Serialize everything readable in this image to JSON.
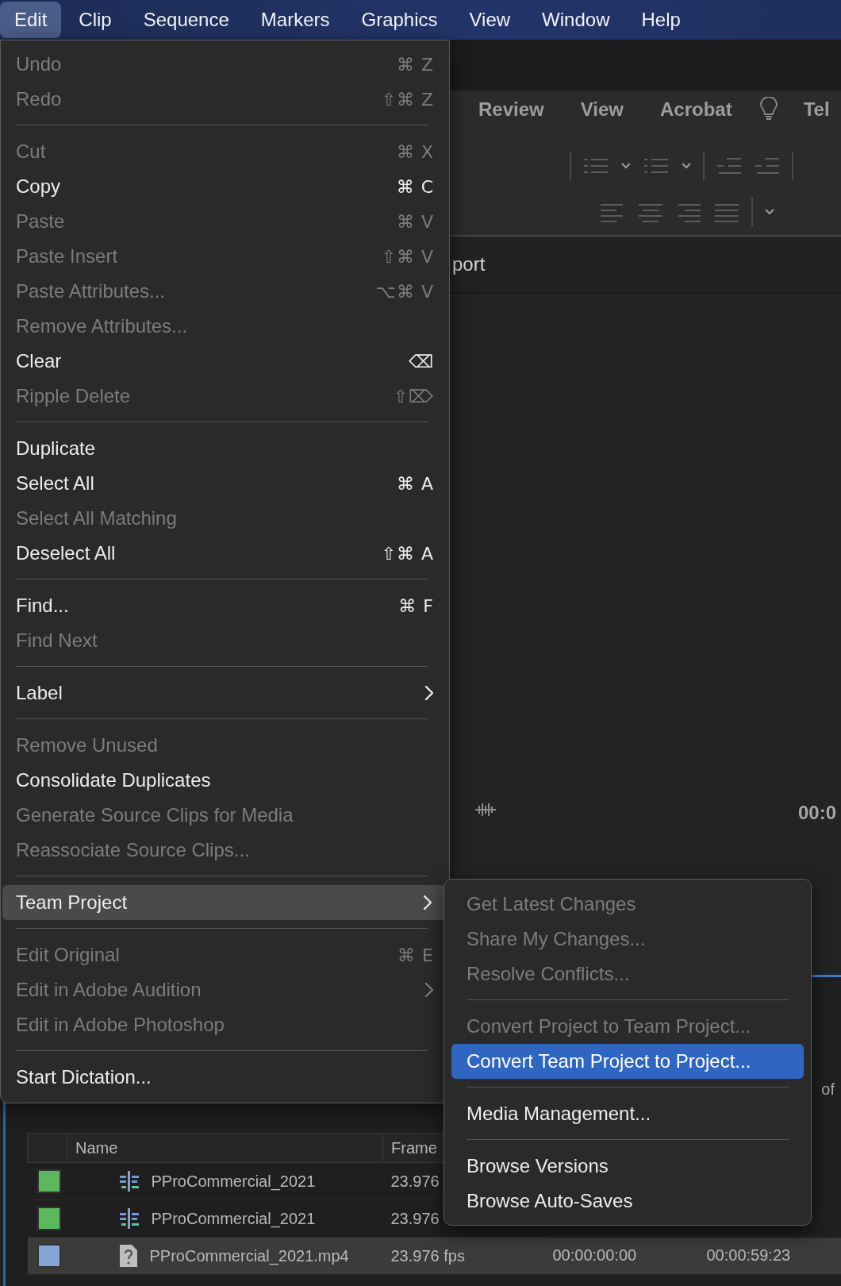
{
  "menu_bar": [
    {
      "label": "Edit",
      "selected": true
    },
    {
      "label": "Clip",
      "selected": false
    },
    {
      "label": "Sequence",
      "selected": false
    },
    {
      "label": "Markers",
      "selected": false
    },
    {
      "label": "Graphics",
      "selected": false
    },
    {
      "label": "View",
      "selected": false
    },
    {
      "label": "Window",
      "selected": false
    },
    {
      "label": "Help",
      "selected": false
    }
  ],
  "ribbon": {
    "tabs": [
      "Review",
      "View",
      "Acrobat",
      "Tel"
    ]
  },
  "export_bar": {
    "label": "port"
  },
  "monitor": {
    "timecode": "00:0"
  },
  "project_panel": {
    "page_label": "of"
  },
  "table": {
    "columns": [
      "Name",
      "Frame"
    ],
    "rows": [
      {
        "color": "#5cb85c",
        "kind": "sequence",
        "selected": false,
        "cells": [
          "PProCommercial_2021",
          "23.976"
        ]
      },
      {
        "color": "#5cb85c",
        "kind": "sequence",
        "selected": false,
        "cells": [
          "PProCommercial_2021",
          "23.976"
        ]
      },
      {
        "color": "#86a6d8",
        "kind": "file",
        "selected": true,
        "cells": [
          "PProCommercial_2021.mp4",
          "23.976 fps",
          "00:00:00:00",
          "00:00:59:23"
        ]
      }
    ]
  },
  "edit_menu": {
    "items": [
      {
        "kind": "item",
        "label": "Undo",
        "shortcut": "⌘ Z",
        "disabled": true,
        "selected": false,
        "has_submenu": false
      },
      {
        "kind": "item",
        "label": "Redo",
        "shortcut": "⇧⌘ Z",
        "disabled": true,
        "selected": false,
        "has_submenu": false
      },
      {
        "kind": "separator"
      },
      {
        "kind": "item",
        "label": "Cut",
        "shortcut": "⌘ X",
        "disabled": true,
        "selected": false,
        "has_submenu": false
      },
      {
        "kind": "item",
        "label": "Copy",
        "shortcut": "⌘ C",
        "disabled": false,
        "selected": false,
        "has_submenu": false
      },
      {
        "kind": "item",
        "label": "Paste",
        "shortcut": "⌘ V",
        "disabled": true,
        "selected": false,
        "has_submenu": false
      },
      {
        "kind": "item",
        "label": "Paste Insert",
        "shortcut": "⇧⌘ V",
        "disabled": true,
        "selected": false,
        "has_submenu": false
      },
      {
        "kind": "item",
        "label": "Paste Attributes...",
        "shortcut": "⌥⌘ V",
        "disabled": true,
        "selected": false,
        "has_submenu": false
      },
      {
        "kind": "item",
        "label": "Remove Attributes...",
        "disabled": true,
        "selected": false,
        "has_submenu": false
      },
      {
        "kind": "item",
        "label": "Clear",
        "shortcut": "⌫",
        "disabled": false,
        "selected": false,
        "has_submenu": false
      },
      {
        "kind": "item",
        "label": "Ripple Delete",
        "shortcut": "⇧⌦",
        "disabled": true,
        "selected": false,
        "has_submenu": false
      },
      {
        "kind": "separator"
      },
      {
        "kind": "item",
        "label": "Duplicate",
        "disabled": false,
        "selected": false,
        "has_submenu": false
      },
      {
        "kind": "item",
        "label": "Select All",
        "shortcut": "⌘ A",
        "disabled": false,
        "selected": false,
        "has_submenu": false
      },
      {
        "kind": "item",
        "label": "Select All Matching",
        "disabled": true,
        "selected": false,
        "has_submenu": false
      },
      {
        "kind": "item",
        "label": "Deselect All",
        "shortcut": "⇧⌘ A",
        "disabled": false,
        "selected": false,
        "has_submenu": false
      },
      {
        "kind": "separator"
      },
      {
        "kind": "item",
        "label": "Find...",
        "shortcut": "⌘ F",
        "disabled": false,
        "selected": false,
        "has_submenu": false
      },
      {
        "kind": "item",
        "label": "Find Next",
        "disabled": true,
        "selected": false,
        "has_submenu": false
      },
      {
        "kind": "separator"
      },
      {
        "kind": "item",
        "label": "Label",
        "disabled": false,
        "selected": false,
        "has_submenu": true
      },
      {
        "kind": "separator"
      },
      {
        "kind": "item",
        "label": "Remove Unused",
        "disabled": true,
        "selected": false,
        "has_submenu": false
      },
      {
        "kind": "item",
        "label": "Consolidate Duplicates",
        "disabled": false,
        "selected": false,
        "has_submenu": false
      },
      {
        "kind": "item",
        "label": "Generate Source Clips for Media",
        "disabled": true,
        "selected": false,
        "has_submenu": false
      },
      {
        "kind": "item",
        "label": "Reassociate Source Clips...",
        "disabled": true,
        "selected": false,
        "has_submenu": false
      },
      {
        "kind": "separator"
      },
      {
        "kind": "item",
        "label": "Team Project",
        "disabled": false,
        "selected": true,
        "has_submenu": true
      },
      {
        "kind": "separator"
      },
      {
        "kind": "item",
        "label": "Edit Original",
        "shortcut": "⌘ E",
        "disabled": true,
        "selected": false,
        "has_submenu": false
      },
      {
        "kind": "item",
        "label": "Edit in Adobe Audition",
        "disabled": true,
        "selected": false,
        "has_submenu": true
      },
      {
        "kind": "item",
        "label": "Edit in Adobe Photoshop",
        "disabled": true,
        "selected": false,
        "has_submenu": false
      },
      {
        "kind": "separator"
      },
      {
        "kind": "item",
        "label": "Start Dictation...",
        "disabled": false,
        "selected": false,
        "has_submenu": false
      }
    ]
  },
  "team_project_submenu": {
    "items": [
      {
        "kind": "item",
        "label": "Get Latest Changes",
        "disabled": true,
        "selected": false,
        "has_submenu": false
      },
      {
        "kind": "item",
        "label": "Share My Changes...",
        "disabled": true,
        "selected": false,
        "has_submenu": false
      },
      {
        "kind": "item",
        "label": "Resolve Conflicts...",
        "disabled": true,
        "selected": false,
        "has_submenu": false
      },
      {
        "kind": "separator"
      },
      {
        "kind": "item",
        "label": "Convert Project to Team Project...",
        "disabled": true,
        "selected": false,
        "has_submenu": false
      },
      {
        "kind": "item",
        "label": "Convert Team Project to Project...",
        "disabled": false,
        "selected": true,
        "has_submenu": false
      },
      {
        "kind": "separator"
      },
      {
        "kind": "item",
        "label": "Media Management...",
        "disabled": false,
        "selected": false,
        "has_submenu": false
      },
      {
        "kind": "separator"
      },
      {
        "kind": "item",
        "label": "Browse Versions",
        "disabled": false,
        "selected": false,
        "has_submenu": false
      },
      {
        "kind": "item",
        "label": "Browse Auto-Saves",
        "disabled": false,
        "selected": false,
        "has_submenu": false
      }
    ]
  }
}
